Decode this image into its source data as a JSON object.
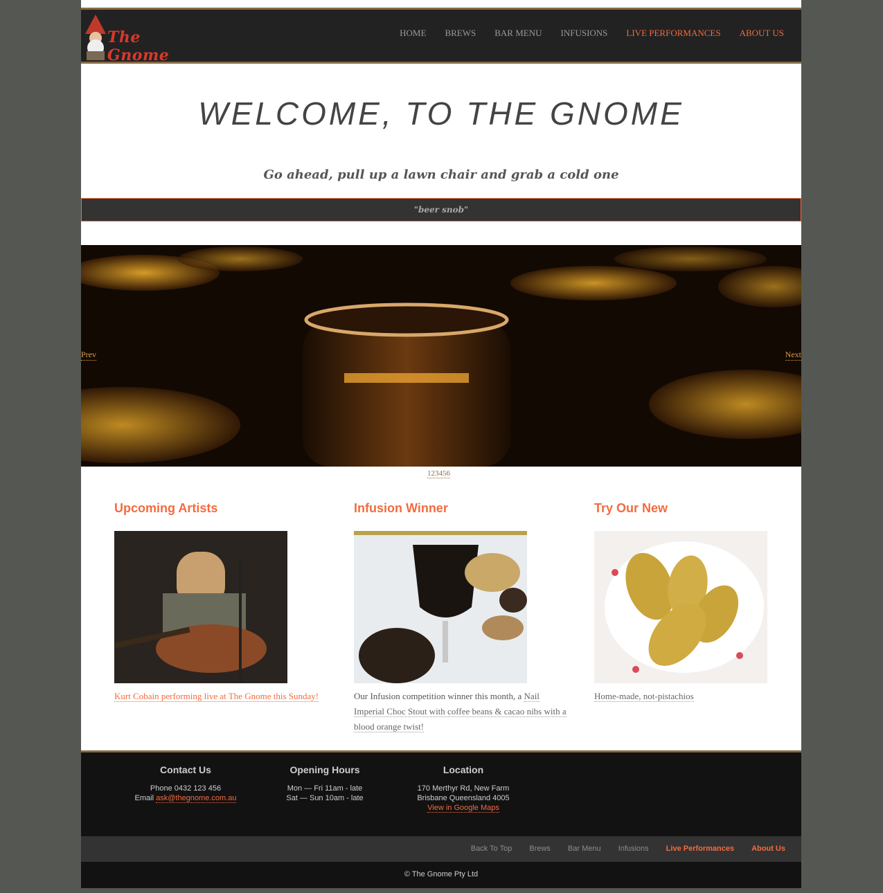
{
  "brand": {
    "name": "The Gnome"
  },
  "nav": {
    "items": [
      {
        "label": "HOME",
        "hl": false
      },
      {
        "label": "BREWS",
        "hl": false
      },
      {
        "label": "BAR MENU",
        "hl": false
      },
      {
        "label": "INFUSIONS",
        "hl": false
      },
      {
        "label": "LIVE PERFORMANCES",
        "hl": true
      },
      {
        "label": "ABOUT US",
        "hl": true
      }
    ]
  },
  "hero": {
    "title": "WELCOME, TO THE GNOME",
    "tagline": "Go ahead, pull up a lawn chair and grab a cold one",
    "quote": "\"beer snob\""
  },
  "slider": {
    "prev": "Prev",
    "next": "Next",
    "pager": "123456"
  },
  "columns": [
    {
      "title": "Upcoming Artists",
      "caption_link": "Kurt Cobain performing live at The Gnome this Sunday!"
    },
    {
      "title": "Infusion Winner",
      "caption_pre": "Our Infusion competition winner this month, a ",
      "caption_link": "Nail Imperial Choc Stout with coffee beans & cacao nibs with a blood orange twist!"
    },
    {
      "title": "Try Our New",
      "caption_link": "Home-made, not-pistachios"
    }
  ],
  "footer": {
    "contact": {
      "title": "Contact Us",
      "phone": "Phone 0432 123 456",
      "email_label": "Email ",
      "email": "ask@thegnome.com.au"
    },
    "hours": {
      "title": "Opening Hours",
      "line1": "Mon — Fri 11am - late",
      "line2": "Sat — Sun 10am - late"
    },
    "location": {
      "title": "Location",
      "line1": "170 Merthyr Rd, New Farm",
      "line2": "Brisbane Queensland 4005",
      "map": "View in Google Maps"
    }
  },
  "footer_nav": {
    "items": [
      {
        "label": "Back To Top",
        "hl": false
      },
      {
        "label": "Brews",
        "hl": false
      },
      {
        "label": "Bar Menu",
        "hl": false
      },
      {
        "label": "Infusions",
        "hl": false
      },
      {
        "label": "Live Performances",
        "hl": true
      },
      {
        "label": "About Us",
        "hl": true
      }
    ]
  },
  "copyright": "© The Gnome Pty Ltd",
  "colors": {
    "accent": "#f36b3f",
    "bar": "#222222",
    "trim": "#8a6a45",
    "outer": "#555753"
  },
  "icons": [
    "gnome-logo-icon"
  ]
}
